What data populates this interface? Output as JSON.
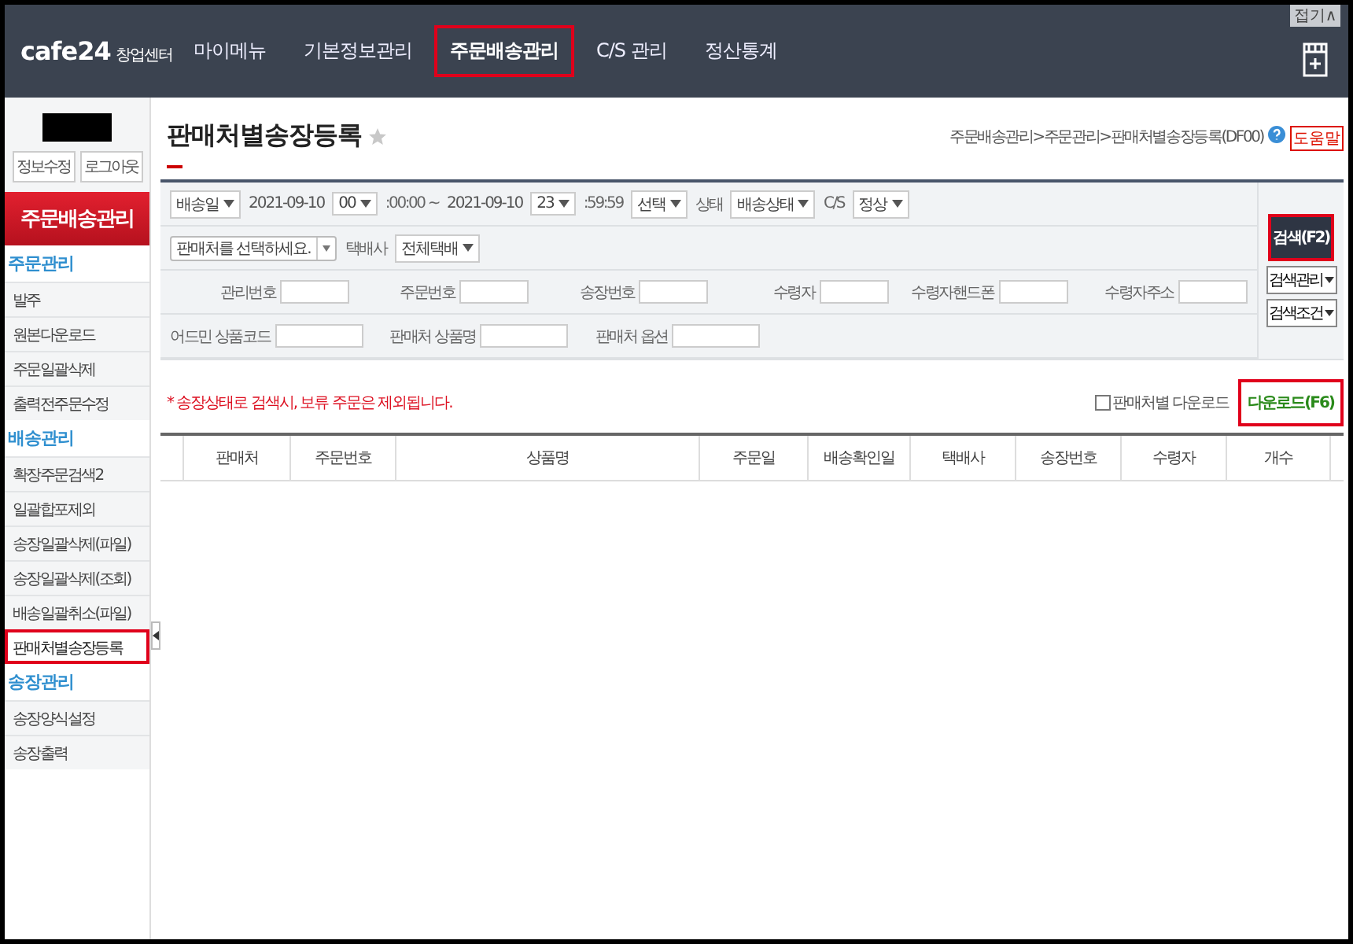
{
  "header": {
    "logo": "cafe24",
    "logo_sub": "창업센터",
    "nav": [
      {
        "label": "마이메뉴",
        "selected": false,
        "highlighted": false
      },
      {
        "label": "기본정보관리",
        "selected": false,
        "highlighted": false
      },
      {
        "label": "주문배송관리",
        "selected": true,
        "highlighted": true
      },
      {
        "label": "C/S 관리",
        "selected": false,
        "highlighted": false
      },
      {
        "label": "정산통계",
        "selected": false,
        "highlighted": false
      }
    ],
    "fold": "접기∧"
  },
  "sidebar": {
    "user_buttons": [
      "정보수정",
      "로그아웃"
    ],
    "title": "주문배송관리",
    "sections": [
      {
        "title": "주문관리",
        "items": [
          {
            "label": "발주",
            "selected": false,
            "highlighted": false
          },
          {
            "label": "원본다운로드",
            "selected": false,
            "highlighted": false
          },
          {
            "label": "주문일괄삭제",
            "selected": false,
            "highlighted": false
          },
          {
            "label": "출력전주문수정",
            "selected": false,
            "highlighted": false
          }
        ]
      },
      {
        "title": "배송관리",
        "items": [
          {
            "label": "확장주문검색2",
            "selected": false,
            "highlighted": false
          },
          {
            "label": "일괄합포제외",
            "selected": false,
            "highlighted": false
          },
          {
            "label": "송장일괄삭제(파일)",
            "selected": false,
            "highlighted": false
          },
          {
            "label": "송장일괄삭제(조회)",
            "selected": false,
            "highlighted": false
          },
          {
            "label": "배송일괄취소(파일)",
            "selected": false,
            "highlighted": false
          },
          {
            "label": "판매처별송장등록",
            "selected": true,
            "highlighted": true
          }
        ]
      },
      {
        "title": "송장관리",
        "items": [
          {
            "label": "송장양식설정",
            "selected": false,
            "highlighted": false
          },
          {
            "label": "송장출력",
            "selected": false,
            "highlighted": false
          }
        ]
      }
    ]
  },
  "page": {
    "title": "판매처별송장등록",
    "favorite": false,
    "breadcrumb": "주문배송관리>주문관리>판매처별송장등록(DF00)",
    "help": "도움말"
  },
  "filters": {
    "date_line": [
      {
        "kind": "select",
        "value": "배송일"
      },
      {
        "kind": "date",
        "value": "2021-09-10"
      },
      {
        "kind": "select",
        "value": "00"
      },
      {
        "kind": "text",
        "label": ":00:00 ~"
      },
      {
        "kind": "date",
        "value": "2021-09-10"
      },
      {
        "kind": "select",
        "value": "23"
      },
      {
        "kind": "text",
        "label": ":59:59"
      },
      {
        "kind": "select",
        "value": "선택"
      },
      {
        "kind": "text",
        "label": "상태"
      },
      {
        "kind": "select",
        "value": "배송상태"
      },
      {
        "kind": "text",
        "label": "C/S"
      },
      {
        "kind": "select",
        "value": "정상"
      }
    ],
    "seller_line": [
      {
        "kind": "combo",
        "value": "판매처를 선택하세요."
      },
      {
        "kind": "text",
        "label": "택배사"
      },
      {
        "kind": "select",
        "value": "전체택배"
      }
    ],
    "order_fields": [
      "관리번호",
      "주문번호",
      "송장번호",
      "수령자",
      "수령자핸드폰",
      "수령자주소"
    ],
    "product_fields": [
      "어드민 상품코드",
      "판매처 상품명",
      "판매처 옵션"
    ],
    "search_button": {
      "label": "검색(F2)",
      "highlighted": true
    },
    "menus": [
      "검색관리",
      "검색조건"
    ]
  },
  "notice": "* 송장상태로 검색시, 보류 주문은 제외됩니다.",
  "seller_download": {
    "label": "판매처별 다운로드",
    "checked": false
  },
  "download_button": {
    "label": "다운로드(F6)",
    "highlighted": true
  },
  "table": {
    "columns": [
      "판매처",
      "주문번호",
      "상품명",
      "주문일",
      "배송확인일",
      "택배사",
      "송장번호",
      "수령자",
      "개수"
    ]
  }
}
